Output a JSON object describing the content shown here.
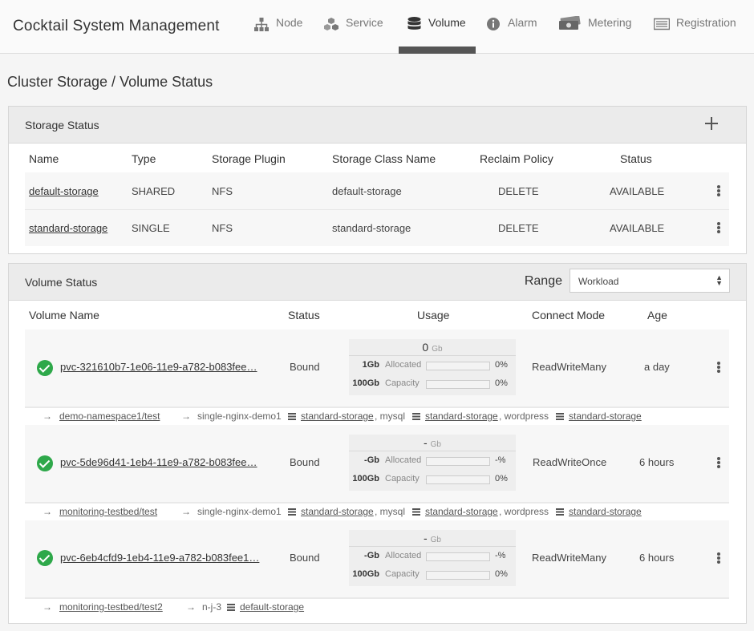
{
  "app": {
    "title": "Cocktail System Management"
  },
  "nav": [
    {
      "label": "Node",
      "icon": "sitemap-icon"
    },
    {
      "label": "Service",
      "icon": "cubes-icon"
    },
    {
      "label": "Volume",
      "icon": "database-icon",
      "active": true
    },
    {
      "label": "Alarm",
      "icon": "info-icon"
    },
    {
      "label": "Metering",
      "icon": "money-icon"
    },
    {
      "label": "Registration",
      "icon": "list-icon"
    }
  ],
  "page": {
    "title": "Cluster Storage / Volume Status"
  },
  "storage": {
    "title": "Storage Status",
    "columns": [
      "Name",
      "Type",
      "Storage Plugin",
      "Storage Class Name",
      "Reclaim Policy",
      "Status"
    ],
    "rows": [
      {
        "name": "default-storage",
        "type": "SHARED",
        "plugin": "NFS",
        "class": "default-storage",
        "reclaim": "DELETE",
        "status": "AVAILABLE"
      },
      {
        "name": "standard-storage",
        "type": "SINGLE",
        "plugin": "NFS",
        "class": "standard-storage",
        "reclaim": "DELETE",
        "status": "AVAILABLE"
      }
    ]
  },
  "volume": {
    "title": "Volume Status",
    "range_label": "Range",
    "range_value": "Workload",
    "columns": [
      "Volume Name",
      "Status",
      "Usage",
      "Connect Mode",
      "Age"
    ],
    "usage_labels": {
      "allocated": "Allocated",
      "capacity": "Capacity",
      "unit": "Gb"
    },
    "rows": [
      {
        "name": "pvc-321610b7-1e06-11e9-a782-b083fee…",
        "status": "Bound",
        "used": "0",
        "allocated": "1Gb",
        "allocated_pct": "0%",
        "capacity": "100Gb",
        "capacity_pct": "0%",
        "mode": "ReadWriteMany",
        "age": "a day",
        "namespace": "demo-namespace1/test",
        "workload": "single-nginx-demo1",
        "storage1": "standard-storage",
        "sep1": ", mysql",
        "storage2": "standard-storage",
        "sep2": ", wordpress",
        "storage3": "standard-storage"
      },
      {
        "name": "pvc-5de96d41-1eb4-11e9-a782-b083fee…",
        "status": "Bound",
        "used": "-",
        "allocated": "-Gb",
        "allocated_pct": "-%",
        "capacity": "100Gb",
        "capacity_pct": "0%",
        "mode": "ReadWriteOnce",
        "age": "6 hours",
        "namespace": "monitoring-testbed/test",
        "workload": "single-nginx-demo1",
        "storage1": "standard-storage",
        "sep1": ", mysql",
        "storage2": "standard-storage",
        "sep2": ", wordpress",
        "storage3": "standard-storage"
      },
      {
        "name": "pvc-6eb4cfd9-1eb4-11e9-a782-b083fee1…",
        "status": "Bound",
        "used": "-",
        "allocated": "-Gb",
        "allocated_pct": "-%",
        "capacity": "100Gb",
        "capacity_pct": "0%",
        "mode": "ReadWriteMany",
        "age": "6 hours",
        "namespace": "monitoring-testbed/test2",
        "workload": "n-j-3",
        "storage1": "default-storage"
      }
    ]
  }
}
